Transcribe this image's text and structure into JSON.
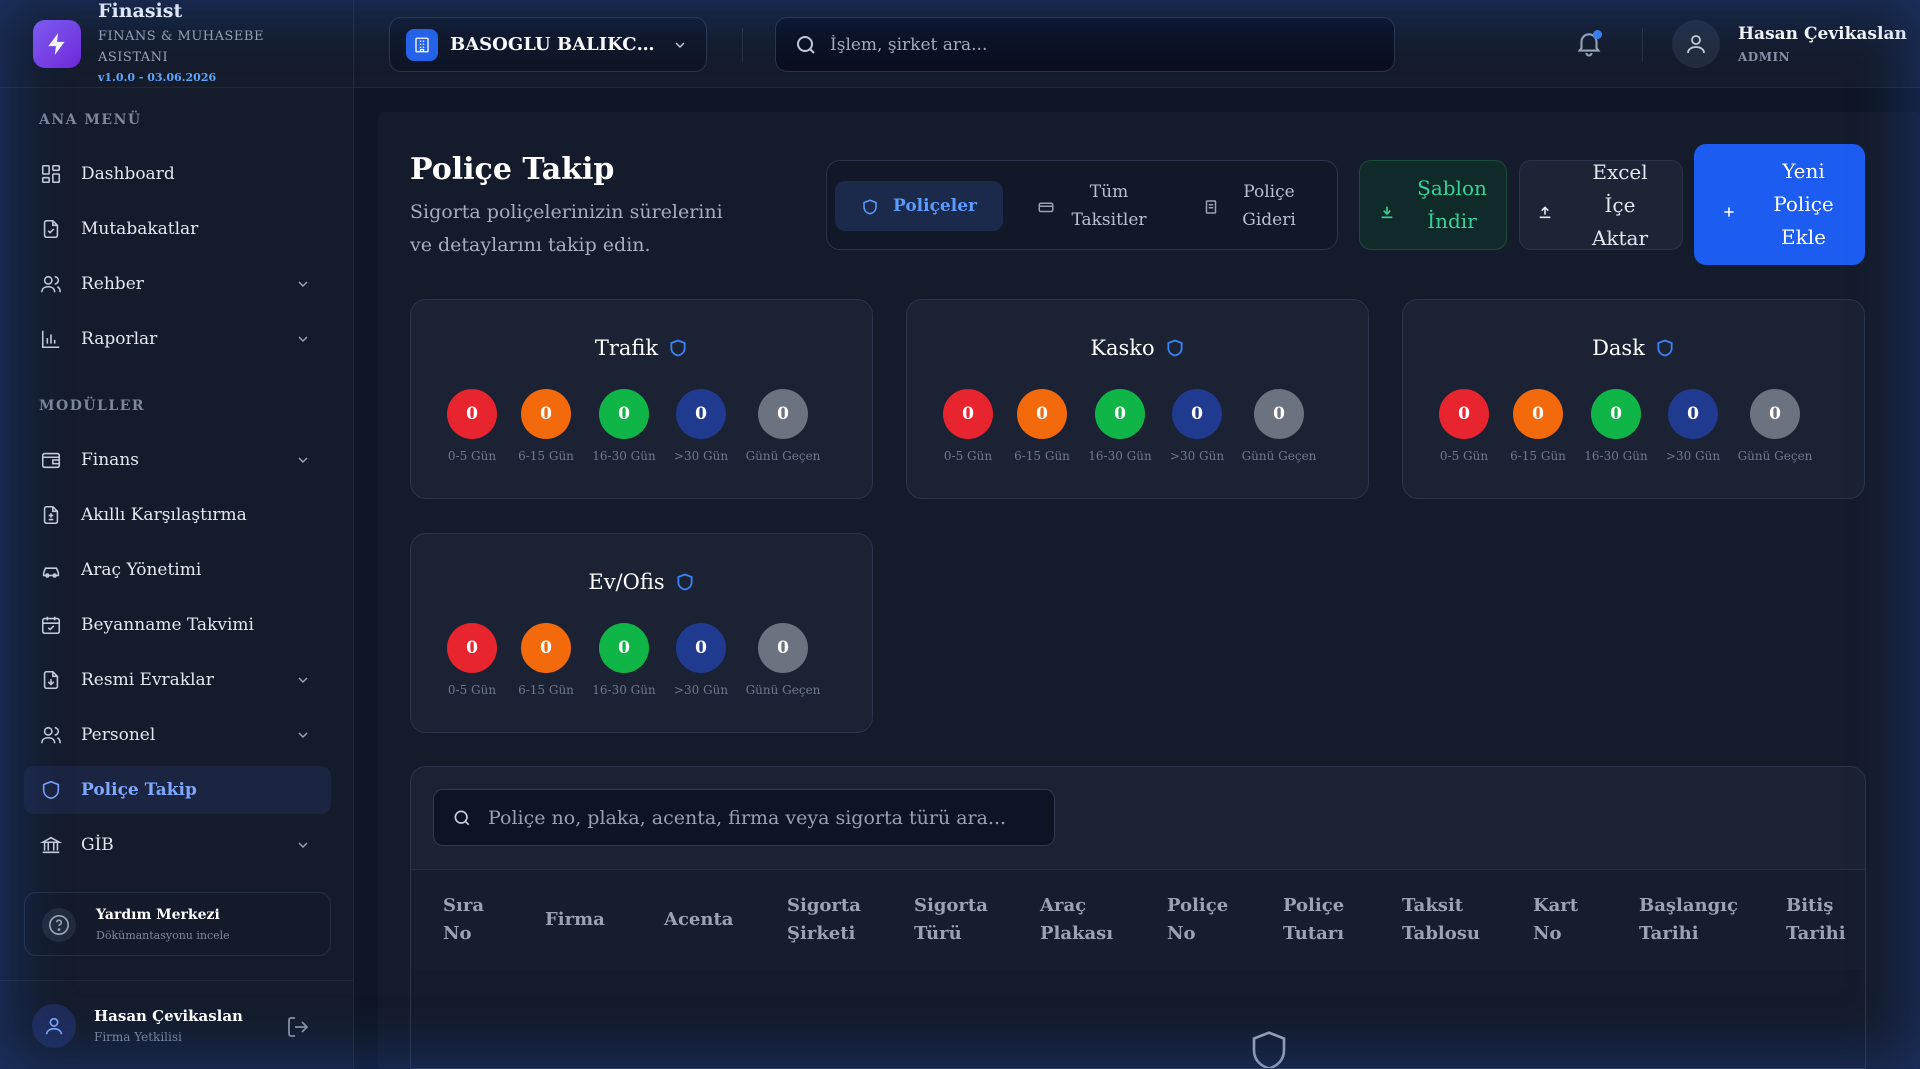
{
  "brand": {
    "title": "Finasist",
    "subtitle": "Finans & Muhasebe Asistanı",
    "version": "v1.0.0 - 03.06.2026"
  },
  "sidebar": {
    "section_main": "ANA MENÜ",
    "section_modules": "MODÜLLER",
    "main_items": [
      {
        "label": "Dashboard",
        "icon": "dashboard-icon",
        "expandable": false
      },
      {
        "label": "Mutabakatlar",
        "icon": "file-check-icon",
        "expandable": false
      },
      {
        "label": "Rehber",
        "icon": "users-icon",
        "expandable": true
      },
      {
        "label": "Raporlar",
        "icon": "bar-chart-icon",
        "expandable": true
      }
    ],
    "module_items": [
      {
        "label": "Finans",
        "icon": "wallet-icon",
        "expandable": true
      },
      {
        "label": "Akıllı Karşılaştırma",
        "icon": "file-diff-icon",
        "expandable": false
      },
      {
        "label": "Araç Yönetimi",
        "icon": "car-icon",
        "expandable": false
      },
      {
        "label": "Beyanname Takvimi",
        "icon": "calendar-icon",
        "expandable": false
      },
      {
        "label": "Resmi Evraklar",
        "icon": "file-download-icon",
        "expandable": true
      },
      {
        "label": "Personel",
        "icon": "users-icon",
        "expandable": true
      },
      {
        "label": "Poliçe Takip",
        "icon": "shield-icon",
        "expandable": false,
        "active": true
      },
      {
        "label": "GİB",
        "icon": "bank-icon",
        "expandable": true
      }
    ],
    "help": {
      "title": "Yardım Merkezi",
      "subtitle": "Dökümantasyonu incele"
    },
    "user": {
      "name": "Hasan Çevikaslan",
      "role": "Firma Yetkilisi"
    }
  },
  "topbar": {
    "company": "BASOGLU BALIKCILIK",
    "search_placeholder": "İşlem, şirket ara...",
    "user_name": "Hasan Çevikaslan",
    "user_role": "ADMIN"
  },
  "page": {
    "title": "Poliçe Takip",
    "subtitle": "Sigorta poliçelerinizin sürelerini ve detaylarını takip edin.",
    "tabs": [
      {
        "label": "Poliçeler",
        "active": true
      },
      {
        "label": "Tüm Taksitler",
        "active": false
      },
      {
        "label": "Poliçe Gideri",
        "active": false
      }
    ],
    "btn_template": "Şablon İndir",
    "btn_import": "Excel İçe Aktar",
    "btn_new": "Yeni Poliçe Ekle"
  },
  "status_labels": [
    "0-5 Gün",
    "6-15 Gün",
    "16-30 Gün",
    ">30 Gün",
    "Günü Geçen"
  ],
  "status_colors": [
    "#e8252f",
    "#f26a0c",
    "#10b548",
    "#1f3a8f",
    "#6b7280"
  ],
  "cards": [
    {
      "title": "Trafik",
      "counts": [
        0,
        0,
        0,
        0,
        0
      ]
    },
    {
      "title": "Kasko",
      "counts": [
        0,
        0,
        0,
        0,
        0
      ]
    },
    {
      "title": "Dask",
      "counts": [
        0,
        0,
        0,
        0,
        0
      ]
    },
    {
      "title": "Ev/Ofis",
      "counts": [
        0,
        0,
        0,
        0,
        0
      ]
    }
  ],
  "table": {
    "search_placeholder": "Poliçe no, plaka, acenta, firma veya sigorta türü ara...",
    "columns": [
      [
        "Sıra",
        "No"
      ],
      [
        "Firma"
      ],
      [
        "Acenta"
      ],
      [
        "Sigorta",
        "Şirketi"
      ],
      [
        "Sigorta",
        "Türü"
      ],
      [
        "Araç",
        "Plakası"
      ],
      [
        "Poliçe",
        "No"
      ],
      [
        "Poliçe",
        "Tutarı"
      ],
      [
        "Taksit",
        "Tablosu"
      ],
      [
        "Kart",
        "No"
      ],
      [
        "Başlangıç",
        "Tarihi"
      ],
      [
        "Bitiş",
        "Tarihi"
      ]
    ]
  }
}
